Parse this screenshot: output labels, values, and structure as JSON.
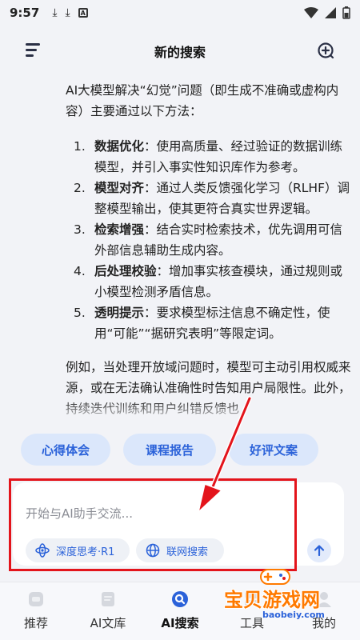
{
  "status_bar": {
    "time": "9:57",
    "badge": "A"
  },
  "header": {
    "title": "新的搜索"
  },
  "answer": {
    "intro": "AI大模型解决“幻觉”问题（即生成不准确或虚构内容）主要通过以下方法：",
    "items": [
      {
        "num": "1.",
        "title": "数据优化",
        "text": "：使用高质量、经过验证的数据训练模型，并引入事实性知识库作为参考。"
      },
      {
        "num": "2.",
        "title": "模型对齐",
        "text": "：通过人类反馈强化学习（RLHF）调整模型输出，使其更符合真实世界逻辑。"
      },
      {
        "num": "3.",
        "title": "检索增强",
        "text": "：结合实时检索技术，优先调用可信外部信息辅助生成内容。"
      },
      {
        "num": "4.",
        "title": "后处理校验",
        "text": "：增加事实核查模块，通过规则或小模型检测矛盾信息。"
      },
      {
        "num": "5.",
        "title": "透明提示",
        "text": "：要求模型标注信息不确定性，使用“可能”“据研究表明”等限定词。"
      }
    ],
    "outro": "例如，当处理开放域问题时，模型可主动引用权威来源，或在无法确认准确性时告知用户局限性。此外，持续迭代训练和用户纠错反馈也"
  },
  "suggestions": [
    "心得体会",
    "课程报告",
    "好评文案"
  ],
  "input": {
    "placeholder": "开始与AI助手交流...",
    "deep_think_label": "深度思考·R1",
    "web_search_label": "联网搜索"
  },
  "tabs": [
    {
      "label": "推荐",
      "icon": "home-icon"
    },
    {
      "label": "AI文库",
      "icon": "library-icon"
    },
    {
      "label": "AI搜索",
      "icon": "search-icon"
    },
    {
      "label": "工具",
      "icon": "tools-icon"
    },
    {
      "label": "我的",
      "icon": "profile-icon"
    }
  ],
  "active_tab": "AI搜索",
  "watermark": {
    "text": "宝贝游戏网",
    "url": "baobeiy.com"
  },
  "colors": {
    "accent": "#2b62d9",
    "chip_bg": "#dbe7fb",
    "highlight": "#e3141b",
    "background": "#f2f3f7"
  }
}
